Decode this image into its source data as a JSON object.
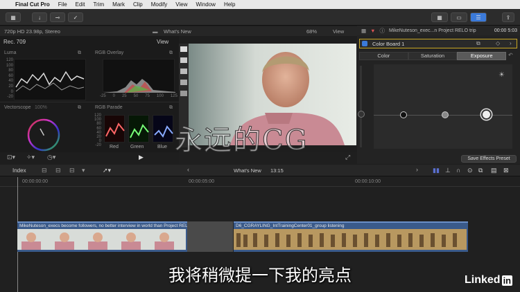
{
  "menubar": {
    "app": "Final Cut Pro",
    "items": [
      "File",
      "Edit",
      "Trim",
      "Mark",
      "Clip",
      "Modify",
      "View",
      "Window",
      "Help"
    ]
  },
  "viewer_header": {
    "format": "720p HD 23.98p, Stereo",
    "title": "What's New",
    "zoom": "68%",
    "view": "View"
  },
  "scopes": {
    "rec": "Rec. 709",
    "view": "View",
    "luma": "Luma",
    "luma_ticks": [
      "120",
      "100",
      "80",
      "60",
      "40",
      "20",
      "0",
      "-20"
    ],
    "rgb_overlay": "RGB Overlay",
    "overlay_ticks": [
      "-25",
      "0",
      "25",
      "50",
      "75",
      "100",
      "125"
    ],
    "vectorscope": "Vectorscope",
    "vector_pct": "100%",
    "rgb_parade": "RGB Parade",
    "parade_ticks": [
      "120",
      "100",
      "80",
      "60",
      "40",
      "20",
      "0",
      "-20"
    ],
    "parade_labels": [
      "Red",
      "Green",
      "Blue"
    ]
  },
  "inspector": {
    "clip_name": "MikeNuteson_exec...n Project RELO trip",
    "timecode": "00:00 5:03",
    "effect": "Color Board 1",
    "tabs": [
      "Color",
      "Saturation",
      "Exposure"
    ],
    "save_preset": "Save Effects Preset"
  },
  "timeline": {
    "index": "Index",
    "project": "What's New",
    "duration": "13:15",
    "ruler": [
      "00:00:00:00",
      "00:00:05:00",
      "00:00:10:00"
    ],
    "clip1": "MikeNuteson_execs become followers, no better interview in world than Project RELO...",
    "clip2": "D6_CGRAYLING_IntTrainingCenter01_group listening"
  },
  "overlay": {
    "subtitle": "我将稍微提一下我的亮点",
    "watermark": "永远的CG",
    "brand": "Linked",
    "brand_in": "in"
  },
  "colors": {
    "accent": "#3b7ad9",
    "clip": "#3a5a8a",
    "audio_blue": "#5a6fd0"
  }
}
